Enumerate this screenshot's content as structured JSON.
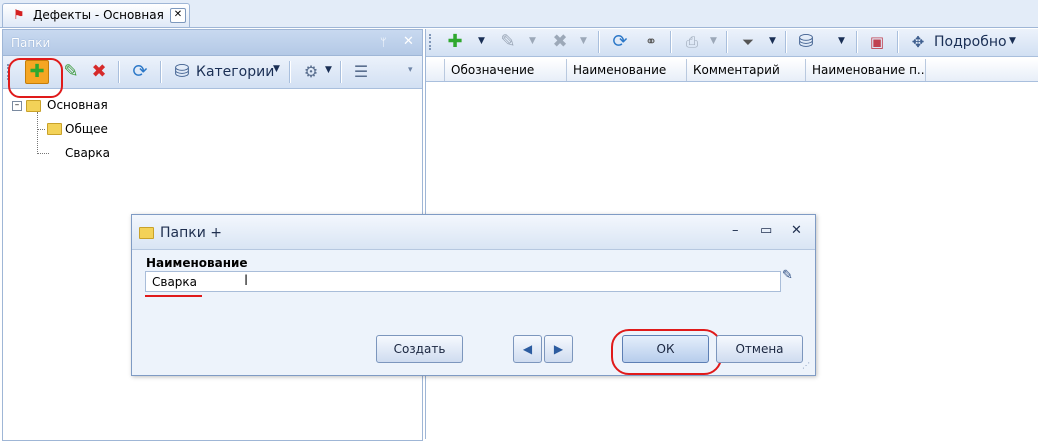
{
  "doc_tab": {
    "title": "Дефекты - Основная",
    "close": "✕"
  },
  "left_panel": {
    "title": "Папки",
    "pin": "ᛘ",
    "close": "✕",
    "toolbar": {
      "categories_label": "Категории"
    },
    "tree": {
      "root": "Основная",
      "children": [
        "Общее",
        "Сварка"
      ]
    }
  },
  "right_panel": {
    "toolbar": {
      "details_label": "Подробно"
    },
    "columns": [
      "Обозначение",
      "Наименование",
      "Комментарий",
      "Наименование п..."
    ]
  },
  "dialog": {
    "title": "Папки +",
    "field_label": "Наименование",
    "field_value": "Сварка",
    "create_button": "Создать",
    "ok_button": "ОК",
    "cancel_button": "Отмена",
    "minimize": "–",
    "maximize": "▭",
    "close": "✕"
  },
  "colors": {
    "highlight_ring": "#e01a1a",
    "accent": "#2c78c8"
  }
}
